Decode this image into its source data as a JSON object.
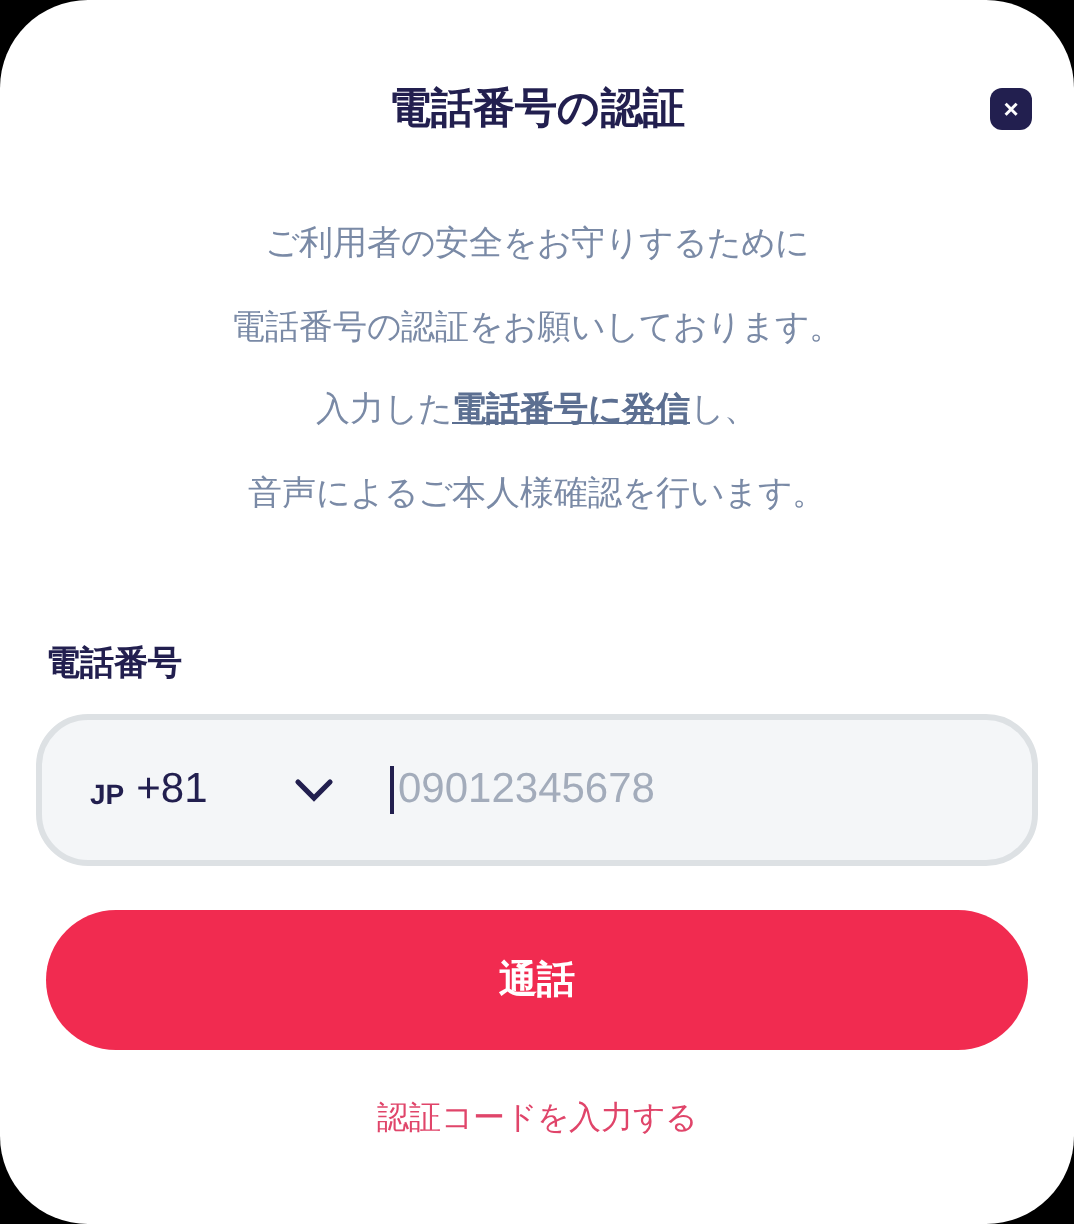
{
  "dialog": {
    "title": "電話番号の認証",
    "close": "×"
  },
  "intro": {
    "lines": [
      "ご利用者の安全をお守りするために",
      "電話番号の認証をお願いしております。"
    ],
    "before_link": "入力した",
    "link": "電話番号に発信",
    "after_link": "し、",
    "last_line": "音声によるご本人様確認を行います。"
  },
  "phone": {
    "label": "電話番号",
    "country_code": "JP",
    "dial_code": "+81",
    "placeholder": "09012345678",
    "focused": true
  },
  "buttons": [
    {
      "kind": "primary",
      "label": "通話"
    },
    {
      "kind": "link",
      "label": "認証コードを入力する"
    }
  ]
}
